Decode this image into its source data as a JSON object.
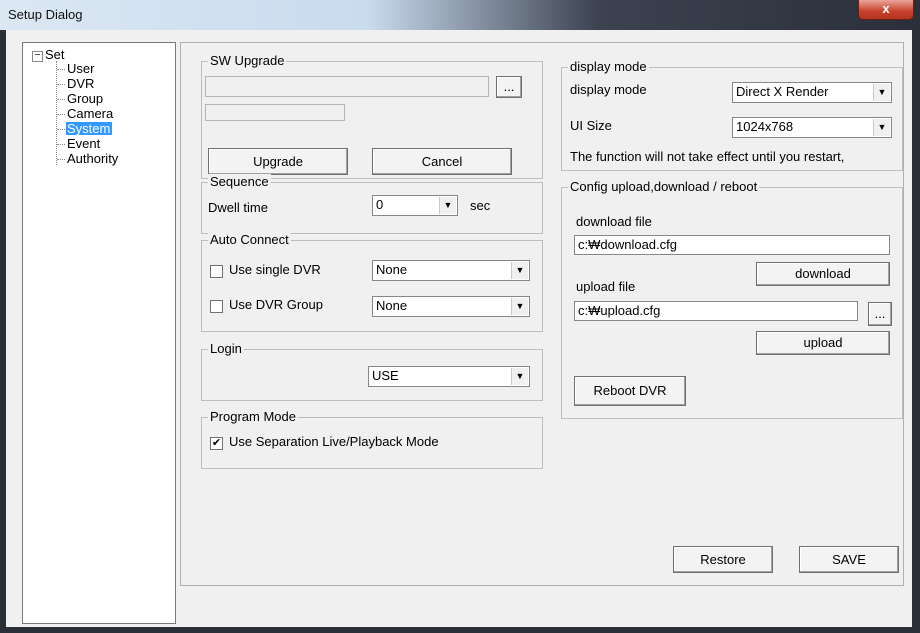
{
  "window": {
    "title": "Setup Dialog",
    "close_label": "x"
  },
  "tree": {
    "root_label": "Set",
    "expander": "−",
    "items": [
      "User",
      "DVR",
      "Group",
      "Camera",
      "System",
      "Event",
      "Authority"
    ],
    "selected": "System"
  },
  "sw_upgrade": {
    "legend": "SW Upgrade",
    "file_value": "",
    "browse_label": "...",
    "upgrade_label": "Upgrade",
    "cancel_label": "Cancel"
  },
  "sequence": {
    "legend": "Sequence",
    "dwell_label": "Dwell time",
    "dwell_value": "0",
    "unit": "sec"
  },
  "auto_connect": {
    "legend": "Auto Connect",
    "single_dvr_label": "Use single DVR",
    "single_dvr_checked": false,
    "single_dvr_value": "None",
    "dvr_group_label": "Use DVR Group",
    "dvr_group_checked": false,
    "dvr_group_value": "None"
  },
  "login": {
    "legend": "Login",
    "value": "USE"
  },
  "program_mode": {
    "legend": "Program Mode",
    "separation_label": "Use Separation Live/Playback Mode",
    "separation_checked": true,
    "check_mark": "✔"
  },
  "display_mode": {
    "legend": "display mode",
    "mode_label": "display mode",
    "mode_value": "Direct X Render",
    "ui_size_label": "UI Size",
    "ui_size_value": "1024x768",
    "restart_note": "The function will not take effect until you restart,"
  },
  "config": {
    "legend": "Config upload,download / reboot",
    "download_file_label": "download file",
    "download_file_value": "c:₩download.cfg",
    "download_label": "download",
    "upload_file_label": "upload file",
    "upload_file_value": "c:₩upload.cfg",
    "browse_label": "...",
    "upload_label": "upload",
    "reboot_label": "Reboot DVR"
  },
  "footer": {
    "restore_label": "Restore",
    "save_label": "SAVE"
  },
  "combo_arrow": "▼"
}
